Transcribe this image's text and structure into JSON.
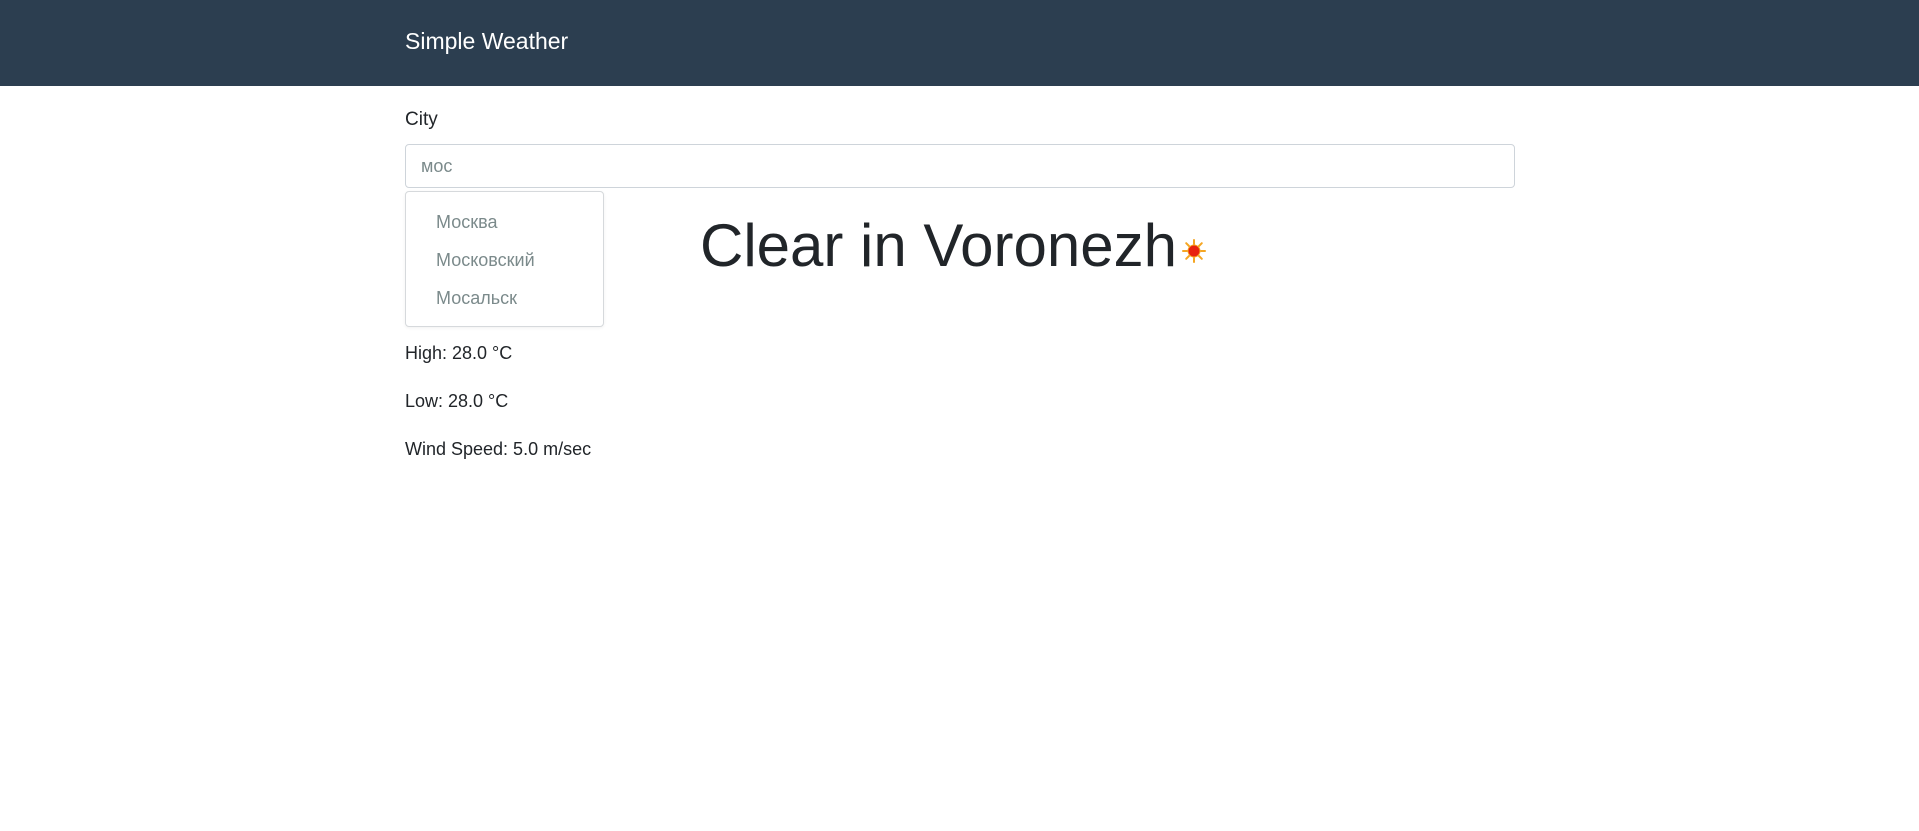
{
  "navbar": {
    "brand": "Simple Weather",
    "background": "#2c3e50"
  },
  "form": {
    "city_label": "City",
    "city_value": "мос"
  },
  "suggestions": [
    {
      "label": "Москва"
    },
    {
      "label": "Московский"
    },
    {
      "label": "Мосальск"
    }
  ],
  "weather": {
    "heading": "Clear in Voronezh",
    "icon": "sun-icon",
    "high": "High: 28.0 °C",
    "low": "Low: 28.0 °C",
    "wind": "Wind Speed: 5.0 m/sec"
  }
}
